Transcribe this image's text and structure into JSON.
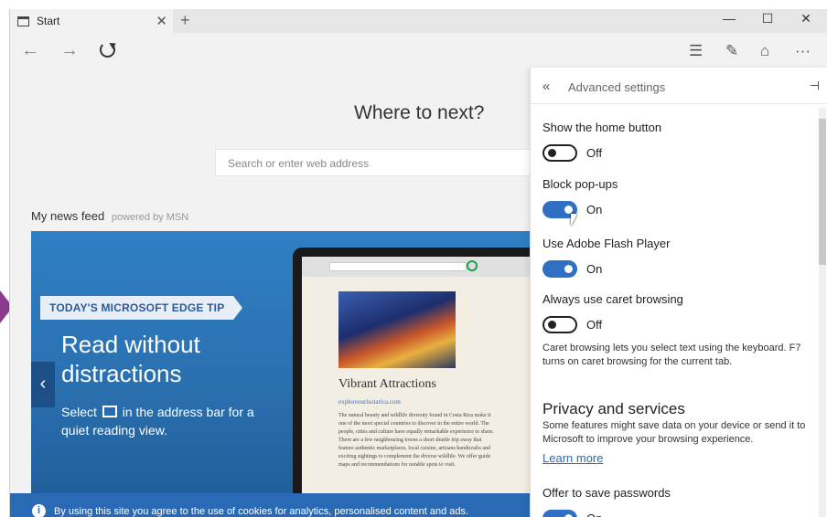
{
  "tab": {
    "title": "Start",
    "close": "✕",
    "new_tab": "+"
  },
  "window_controls": {
    "minimize": "—",
    "maximize": "☐",
    "close": "✕"
  },
  "nav": {
    "back": "←",
    "forward": "→"
  },
  "toolbar": {
    "hub": "☰",
    "note": "✎",
    "share": "⌂",
    "more": "···"
  },
  "start_page": {
    "heading": "Where to next?",
    "search_placeholder": "Search or enter web address",
    "news_feed_label": "My news feed",
    "powered_by": "powered by MSN"
  },
  "hero": {
    "tip_label": "TODAY'S MICROSOFT EDGE TIP",
    "headline_line1": "Read without",
    "headline_line2": "distractions",
    "sub_before": "Select",
    "sub_after": "in the address bar for a quiet reading view.",
    "prev": "‹",
    "next": "›",
    "article_title": "Vibrant Attractions",
    "article_link": "exploreourisotarica.com",
    "article_body": "The natural beauty and wildlife diversity found in Costa Rica make it one of the most special countries to discover in the entire world. The people, cities and culture have equally remarkable experience to share. There are a few neighbouring towns a short shuttle trip away that feature authentic marketplaces, local cuisine, artisans handicrafts and exciting sightings to complement the diverse wildlife. We offer guide maps and recommendations for notable spots to visit."
  },
  "cookie_banner": {
    "icon": "i",
    "text": "By using this site you agree to the use of cookies for analytics, personalised content and ads."
  },
  "settings": {
    "back": "«",
    "title": "Advanced settings",
    "pin": "⊣",
    "home_button": {
      "label": "Show the home button",
      "state": "Off"
    },
    "popups": {
      "label": "Block pop-ups",
      "state": "On"
    },
    "flash": {
      "label": "Use Adobe Flash Player",
      "state": "On"
    },
    "caret": {
      "label": "Always use caret browsing",
      "state": "Off"
    },
    "caret_hint": "Caret browsing lets you select text using the keyboard. F7 turns on caret browsing for the current tab.",
    "privacy_title": "Privacy and services",
    "privacy_hint": "Some features might save data on your device or send it to Microsoft to improve your browsing experience.",
    "learn_more": "Learn more",
    "passwords": {
      "label": "Offer to save passwords",
      "state": "On"
    }
  },
  "colors": {
    "accent": "#2f6fc4",
    "hero": "#2f7fc4",
    "cookie": "#2a6ab4"
  }
}
